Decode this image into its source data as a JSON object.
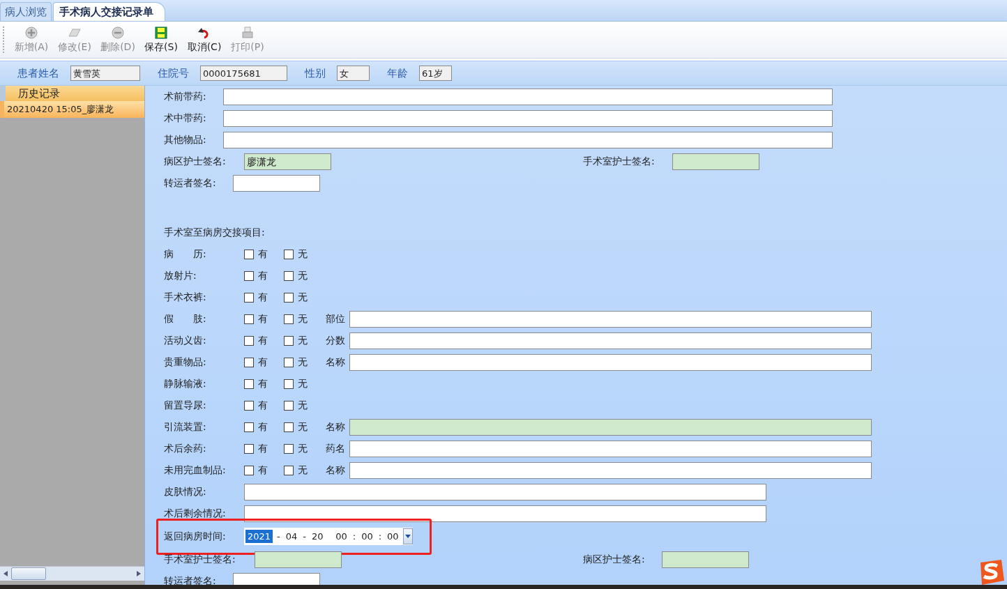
{
  "tabs": [
    {
      "label": "病人浏览",
      "selected": false
    },
    {
      "label": "手术病人交接记录单",
      "selected": true
    }
  ],
  "toolbar": [
    {
      "label": "新增(A)",
      "disabled": true
    },
    {
      "label": "修改(E)",
      "disabled": true
    },
    {
      "label": "删除(D)",
      "disabled": true
    },
    {
      "label": "保存(S)",
      "disabled": false
    },
    {
      "label": "取消(C)",
      "disabled": false
    },
    {
      "label": "打印(P)",
      "disabled": true
    }
  ],
  "patient": [
    {
      "label": "患者姓名",
      "value": "黄雪英"
    },
    {
      "label": "住院号",
      "value": "0000175681"
    },
    {
      "label": "性别",
      "value": "女"
    },
    {
      "label": "年龄",
      "value": "61岁"
    }
  ],
  "history": {
    "title": "历史记录",
    "items": [
      {
        "label": "20210420  15:05_廖潇龙",
        "selected": true
      }
    ]
  },
  "form": [
    {
      "kind": "text",
      "label": "术前带药:"
    },
    {
      "kind": "text",
      "label": "术中带药:"
    },
    {
      "kind": "text",
      "label": "其他物品:"
    },
    {
      "kind": "signs",
      "label": "病区护士签名:",
      "value": "廖潇龙",
      "highlighted": true,
      "label2": "手术室护士签名:",
      "highlighted2": true
    },
    {
      "kind": "sign",
      "label": "转运者签名:",
      "highlighted": false
    },
    {
      "kind": "spacer"
    },
    {
      "kind": "heading",
      "label": "手术室至病房交接项目:"
    },
    {
      "kind": "check",
      "label": "病　　历:",
      "options": [
        {
          "label": "有",
          "checked": false
        },
        {
          "label": "无",
          "checked": false
        }
      ]
    },
    {
      "kind": "check",
      "label": "放射片:",
      "options": [
        {
          "label": "有",
          "checked": false
        },
        {
          "label": "无",
          "checked": false
        }
      ]
    },
    {
      "kind": "check",
      "label": "手术衣裤:",
      "options": [
        {
          "label": "有",
          "checked": false
        },
        {
          "label": "无",
          "checked": false
        }
      ]
    },
    {
      "kind": "check",
      "label": "假　　肢:",
      "options": [
        {
          "label": "有",
          "checked": false
        },
        {
          "label": "无",
          "checked": false
        }
      ],
      "detail": {
        "label": "部位",
        "highlighted": false
      }
    },
    {
      "kind": "check",
      "label": "活动义齿:",
      "options": [
        {
          "label": "有",
          "checked": false
        },
        {
          "label": "无",
          "checked": false
        }
      ],
      "detail": {
        "label": "分数",
        "highlighted": false
      }
    },
    {
      "kind": "check",
      "label": "贵重物品:",
      "options": [
        {
          "label": "有",
          "checked": false
        },
        {
          "label": "无",
          "checked": false
        }
      ],
      "detail": {
        "label": "名称",
        "highlighted": false
      }
    },
    {
      "kind": "check",
      "label": "静脉输液:",
      "options": [
        {
          "label": "有",
          "checked": false
        },
        {
          "label": "无",
          "checked": false
        }
      ]
    },
    {
      "kind": "check",
      "label": "留置导尿:",
      "options": [
        {
          "label": "有",
          "checked": false
        },
        {
          "label": "无",
          "checked": false
        }
      ]
    },
    {
      "kind": "check",
      "label": "引流装置:",
      "options": [
        {
          "label": "有",
          "checked": false
        },
        {
          "label": "无",
          "checked": false
        }
      ],
      "detail": {
        "label": "名称",
        "highlighted": true
      }
    },
    {
      "kind": "check",
      "label": "术后余药:",
      "options": [
        {
          "label": "有",
          "checked": false
        },
        {
          "label": "无",
          "checked": false
        }
      ],
      "detail": {
        "label": "药名",
        "highlighted": false
      }
    },
    {
      "kind": "check",
      "label": "未用完血制品:",
      "options": [
        {
          "label": "有",
          "checked": false
        },
        {
          "label": "无",
          "checked": false
        }
      ],
      "detail": {
        "label": "名称",
        "highlighted": false
      }
    },
    {
      "kind": "medium",
      "label": "皮肤情况:"
    },
    {
      "kind": "medium",
      "label": "术后剩余情况:"
    },
    {
      "kind": "datetime",
      "label": "返回病房时间:",
      "date": [
        "2021",
        "-",
        "04",
        "-",
        "20"
      ],
      "time": [
        "00",
        ":",
        "00",
        ":",
        "00"
      ],
      "year_selected": true,
      "marked": true
    },
    {
      "kind": "signs2",
      "label": "手术室护士签名:",
      "highlighted": true,
      "label2": "病区护士签名:",
      "highlighted2": true
    },
    {
      "kind": "sign",
      "label": "转运者签名:",
      "highlighted": false
    }
  ]
}
